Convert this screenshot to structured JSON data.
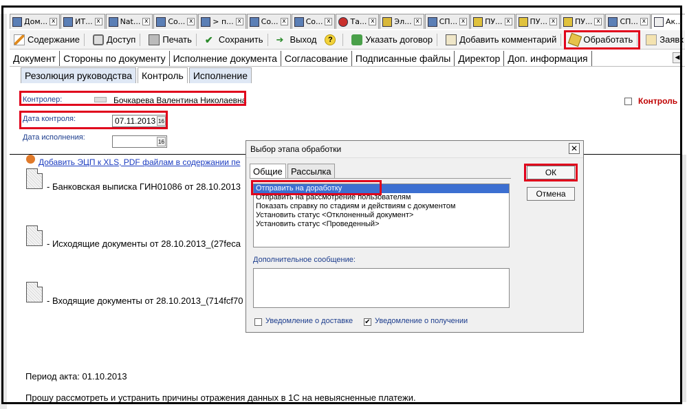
{
  "tabs": [
    {
      "label": "Дом...",
      "active": false
    },
    {
      "label": "ИТ...",
      "active": false
    },
    {
      "label": "Nat...",
      "active": false
    },
    {
      "label": "Со...",
      "active": false
    },
    {
      "label": "> п...",
      "active": false
    },
    {
      "label": "Со...",
      "active": false
    },
    {
      "label": "Со...",
      "active": false
    },
    {
      "label": "Та...",
      "active": false
    },
    {
      "label": "Эл...",
      "active": false
    },
    {
      "label": "СП...",
      "active": false
    },
    {
      "label": "ПУ...",
      "active": false
    },
    {
      "label": "ПУ...",
      "active": false
    },
    {
      "label": "ПУ...",
      "active": false
    },
    {
      "label": "СП...",
      "active": false
    },
    {
      "label": "Ак...",
      "active": true
    }
  ],
  "toolbar": {
    "contents": "Содержание",
    "access": "Доступ",
    "print": "Печать",
    "save": "Сохранить",
    "exit": "Выход",
    "help": "?",
    "contract": "Указать договор",
    "add_comment": "Добавить комментарий",
    "process": "Обработать",
    "requests": "Заявк"
  },
  "doc_tabs": [
    "Документ",
    "Стороны по документу",
    "Исполнение документа",
    "Согласование",
    "Подписанные файлы",
    "Директор",
    "Доп. информация"
  ],
  "sub_tabs": [
    "Резолюция руководства",
    "Контроль",
    "Исполнение"
  ],
  "control": {
    "controller_label": "Контролер:",
    "controller_value": "Бочкарева Валентина Николаевна",
    "control_date_label": "Дата контроля:",
    "control_date_value": "07.11.2013",
    "exec_date_label": "Дата исполнения:",
    "exec_date_value": "",
    "calendar_glyph": "16",
    "control_checkbox_label": "Контроль"
  },
  "content": {
    "add_sig_link": "Добавить ЭЦП к XLS, PDF файлам в содержании пе",
    "file1": "- Банковская выписка ГИН01086 от 28.10.2013",
    "file2": "- Исходящие документы от 28.10.2013_(27feca",
    "file3": "- Входящие документы от 28.10.2013_(714fcf70",
    "period": "Период акта: 01.10.2013",
    "request_text": "Прошу рассмотреть и устранить причины отражения данных в 1С на невыясненные платежи."
  },
  "dialog": {
    "title": "Выбор этапа обработки",
    "close": "✕",
    "tab_general": "Общие",
    "tab_mailing": "Рассылка",
    "options": [
      "Отправить на доработку",
      "Отправить на рассмотрение пользователям",
      "Показать справку по стадиям и действиям с документом",
      "Установить статус <Отклоненный документ>",
      "Установить статус <Проведенный>"
    ],
    "selected_index": 0,
    "extra_message_label": "Дополнительное сообщение:",
    "extra_message_value": "",
    "ok": "ОК",
    "cancel": "Отмена",
    "notify_delivery": "Уведомление о доставке",
    "notify_delivery_checked": false,
    "notify_receipt": "Уведомление о получении",
    "notify_receipt_checked": true
  },
  "colors": {
    "highlight_red": "#e0001b",
    "selection_blue": "#3c6fd1",
    "label_blue": "#1a3b8c"
  }
}
